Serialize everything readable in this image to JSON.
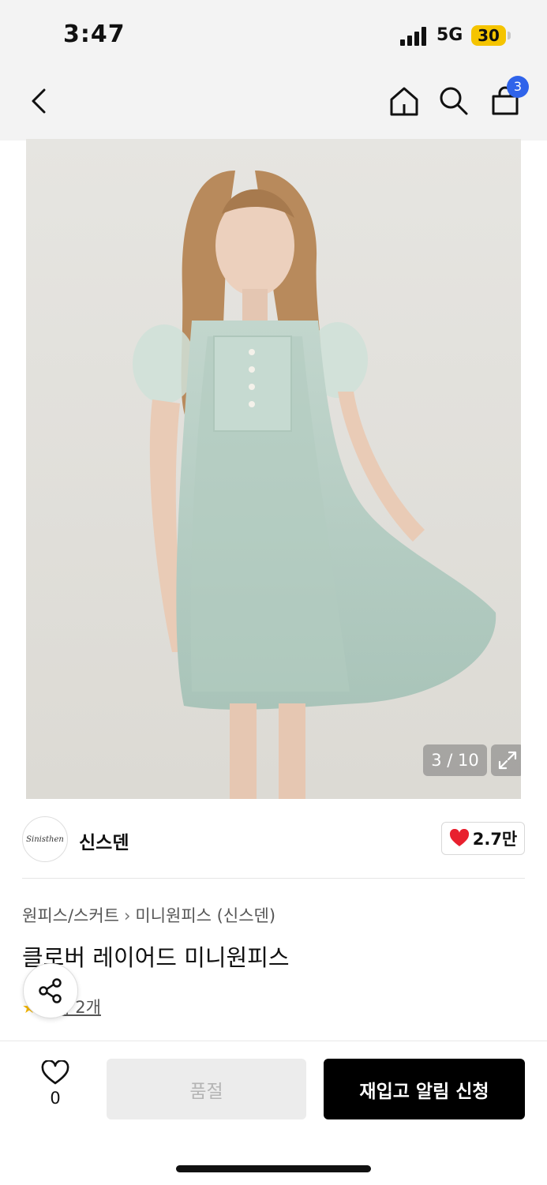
{
  "status_bar": {
    "time": "3:47",
    "network": "5G",
    "battery": "30"
  },
  "header": {
    "cart_count": "3"
  },
  "gallery": {
    "counter": "3 / 10"
  },
  "brand": {
    "logo_text": "Sinisthen",
    "name": "신스덴",
    "likes": "2.7만"
  },
  "product": {
    "breadcrumb": [
      "원피스/스커트",
      "미니원피스 (신스덴)"
    ],
    "title": "클로버 레이어드 미니원피스",
    "review_label": "후기 2개"
  },
  "bottom_bar": {
    "wish_count": "0",
    "soldout_label": "품절",
    "restock_label": "재입고 알림 신청"
  },
  "colors": {
    "accent_blue": "#2f63ea",
    "heart_red": "#e8202e",
    "dress_mint": "#b7cfc4"
  }
}
